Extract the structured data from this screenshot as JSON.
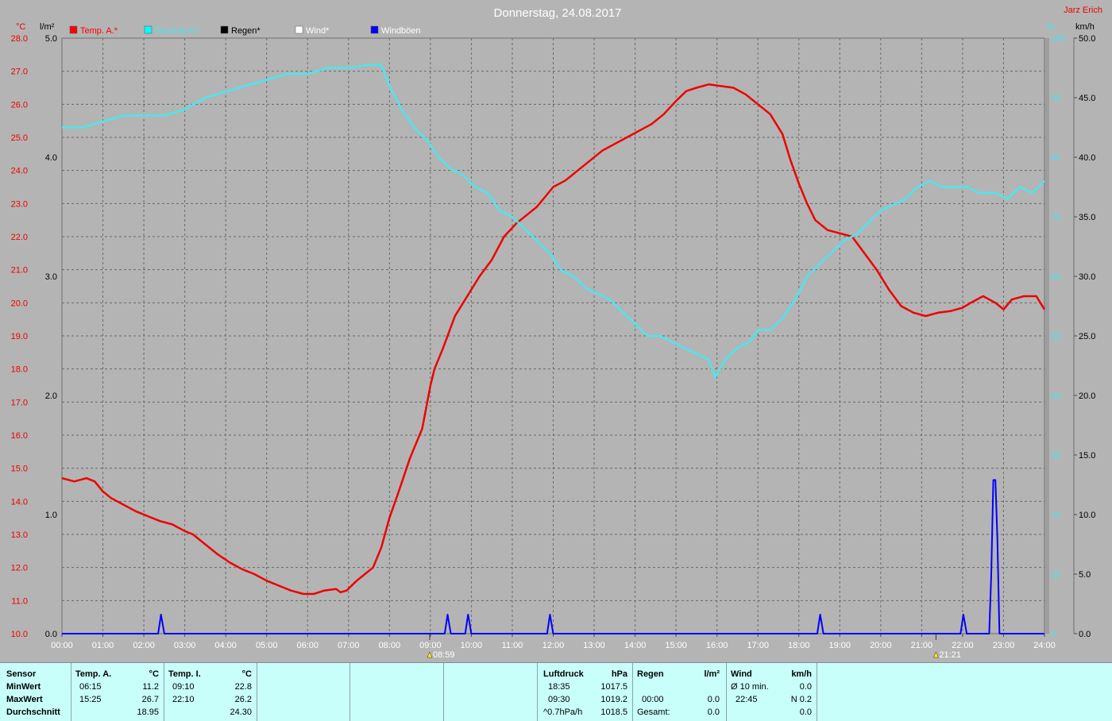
{
  "title": "Donnerstag, 24.08.2017",
  "author": "Jarz Erich",
  "axes": {
    "left_temp_unit": "°C",
    "left_rain_unit": "l/m²",
    "right_hum_unit": "%",
    "right_wind_unit": "km/h"
  },
  "legend": [
    {
      "label": "Temp. A.*",
      "color": "#ff0000",
      "text_color": "#ff0000"
    },
    {
      "label": "Feuchte A.*",
      "color": "#00ffff",
      "text_color": "#44e6ee"
    },
    {
      "label": "Regen*",
      "color": "#000000",
      "text_color": "#000000"
    },
    {
      "label": "Wind*",
      "color": "#ffffff",
      "text_color": "#ffffff"
    },
    {
      "label": "Windböen",
      "color": "#0000ff",
      "text_color": "#ffffff"
    }
  ],
  "markers": [
    {
      "hour": 8.983,
      "label": "08:59"
    },
    {
      "hour": 21.35,
      "label": "21:21"
    }
  ],
  "chart_data": {
    "type": "line",
    "x_unit": "hour",
    "xlim": [
      0,
      24
    ],
    "x_ticks": [
      "00:00",
      "01:00",
      "02:00",
      "03:00",
      "04:00",
      "05:00",
      "06:00",
      "07:00",
      "08:00",
      "09:00",
      "10:00",
      "11:00",
      "12:00",
      "13:00",
      "14:00",
      "15:00",
      "16:00",
      "17:00",
      "18:00",
      "19:00",
      "20:00",
      "21:00",
      "22:00",
      "23:00",
      "24:00"
    ],
    "y_temp": {
      "lim": [
        10,
        28
      ],
      "ticks": [
        "10.0",
        "11.0",
        "12.0",
        "13.0",
        "14.0",
        "15.0",
        "16.0",
        "17.0",
        "18.0",
        "19.0",
        "20.0",
        "21.0",
        "22.0",
        "23.0",
        "24.0",
        "25.0",
        "26.0",
        "27.0",
        "28.0"
      ]
    },
    "y_rain": {
      "lim": [
        0,
        5
      ],
      "ticks": [
        "0.0",
        "1.0",
        "2.0",
        "3.0",
        "4.0",
        "5.0"
      ]
    },
    "y_hum": {
      "lim": [
        0,
        100
      ],
      "ticks": [
        "0",
        "10",
        "20",
        "30",
        "40",
        "50",
        "60",
        "70",
        "80",
        "90",
        "100"
      ]
    },
    "y_wind": {
      "lim": [
        0,
        50
      ],
      "ticks": [
        "0.0",
        "5.0",
        "10.0",
        "15.0",
        "20.0",
        "25.0",
        "30.0",
        "35.0",
        "40.0",
        "45.0",
        "50.0"
      ]
    },
    "grid": true,
    "series": [
      {
        "name": "Temp. A.*",
        "axis": "temp",
        "color": "#ee0000",
        "x": [
          0,
          0.3,
          0.6,
          0.8,
          1.0,
          1.2,
          1.5,
          1.8,
          2.1,
          2.4,
          2.7,
          3.0,
          3.2,
          3.5,
          3.8,
          4.1,
          4.4,
          4.7,
          5.0,
          5.3,
          5.6,
          5.9,
          6.15,
          6.4,
          6.7,
          6.8,
          6.95,
          7.2,
          7.4,
          7.6,
          7.8,
          8.0,
          8.2,
          8.5,
          8.8,
          9.0,
          9.1,
          9.3,
          9.6,
          9.9,
          10.2,
          10.5,
          10.8,
          11.1,
          11.4,
          11.6,
          11.8,
          12.0,
          12.3,
          12.6,
          12.9,
          13.2,
          13.5,
          13.8,
          14.1,
          14.4,
          14.7,
          15.0,
          15.25,
          15.5,
          15.8,
          16.1,
          16.4,
          16.7,
          17.0,
          17.3,
          17.6,
          17.8,
          18.0,
          18.2,
          18.4,
          18.7,
          19.0,
          19.3,
          19.6,
          19.9,
          20.2,
          20.5,
          20.8,
          21.1,
          21.4,
          21.7,
          22.0,
          22.2,
          22.5,
          22.8,
          23.0,
          23.2,
          23.5,
          23.8,
          24.0
        ],
        "y": [
          14.7,
          14.6,
          14.7,
          14.6,
          14.3,
          14.1,
          13.9,
          13.7,
          13.55,
          13.4,
          13.3,
          13.1,
          13.0,
          12.7,
          12.4,
          12.15,
          11.95,
          11.8,
          11.6,
          11.45,
          11.3,
          11.2,
          11.2,
          11.3,
          11.35,
          11.25,
          11.3,
          11.6,
          11.8,
          12.0,
          12.6,
          13.5,
          14.2,
          15.3,
          16.2,
          17.5,
          18.0,
          18.6,
          19.6,
          20.2,
          20.8,
          21.3,
          22.0,
          22.4,
          22.7,
          22.9,
          23.2,
          23.5,
          23.7,
          24.0,
          24.3,
          24.6,
          24.8,
          25.0,
          25.2,
          25.4,
          25.7,
          26.1,
          26.4,
          26.5,
          26.6,
          26.55,
          26.5,
          26.3,
          26.0,
          25.7,
          25.1,
          24.3,
          23.6,
          23.0,
          22.5,
          22.2,
          22.1,
          22.0,
          21.5,
          21.0,
          20.4,
          19.9,
          19.7,
          19.6,
          19.7,
          19.75,
          19.85,
          20.0,
          20.2,
          20.0,
          19.8,
          20.1,
          20.2,
          20.2,
          19.8
        ]
      },
      {
        "name": "Feuchte A.*",
        "axis": "hum",
        "color": "#4ce6ee",
        "x": [
          0,
          0.5,
          1.0,
          1.5,
          2.0,
          2.5,
          3.0,
          3.5,
          4.0,
          4.5,
          5.0,
          5.5,
          6.0,
          6.5,
          7.0,
          7.5,
          7.8,
          8.0,
          8.3,
          8.6,
          8.9,
          9.2,
          9.5,
          9.8,
          10.1,
          10.4,
          10.7,
          11.0,
          11.3,
          11.6,
          11.9,
          12.2,
          12.5,
          12.8,
          13.1,
          13.4,
          13.7,
          14.0,
          14.3,
          14.6,
          14.9,
          15.2,
          15.5,
          15.8,
          15.95,
          16.2,
          16.5,
          16.8,
          17.0,
          17.3,
          17.6,
          17.9,
          18.2,
          18.5,
          18.8,
          19.1,
          19.4,
          19.7,
          20.0,
          20.3,
          20.6,
          20.9,
          21.2,
          21.5,
          21.8,
          22.1,
          22.4,
          22.8,
          23.1,
          23.4,
          23.7,
          24.0
        ],
        "y": [
          85,
          85,
          86,
          87,
          87,
          87,
          88,
          90,
          91,
          92,
          93,
          94,
          94,
          95,
          95,
          95.5,
          95.5,
          92,
          88,
          85,
          83,
          80,
          78,
          77,
          75,
          74,
          71,
          70,
          68,
          66,
          64,
          61,
          60,
          58,
          57,
          56,
          54,
          52,
          50,
          50,
          49,
          48,
          47,
          46,
          43,
          46,
          48,
          49,
          51,
          51,
          53,
          56,
          60,
          62,
          64,
          66,
          67,
          69,
          71,
          72,
          73,
          75,
          76,
          75,
          75,
          75,
          74,
          74,
          73,
          75,
          74,
          76
        ]
      },
      {
        "name": "Windböen",
        "axis": "wind",
        "color": "#0000ff",
        "x": [
          0,
          2.35,
          2.42,
          2.5,
          9.35,
          9.42,
          9.5,
          9.85,
          9.92,
          10.0,
          11.85,
          11.92,
          12.0,
          18.45,
          18.52,
          18.6,
          21.95,
          22.02,
          22.1,
          22.65,
          22.7,
          22.75,
          22.8,
          22.85,
          22.9,
          24.0
        ],
        "y": [
          0,
          0,
          1.6,
          0,
          0,
          1.6,
          0,
          0,
          1.6,
          0,
          0,
          1.6,
          0,
          0,
          1.6,
          0,
          0,
          1.6,
          0,
          0,
          5,
          12.9,
          12.9,
          8,
          0,
          0
        ]
      }
    ]
  },
  "stats": {
    "sensor_header": "Sensor",
    "row_labels": [
      "MinWert",
      "MaxWert",
      "Durchschnitt"
    ],
    "temp_a": {
      "header": "Temp. A.",
      "unit": "°C",
      "min_time": "06:15",
      "min": "11.2",
      "max_time": "15:25",
      "max": "26.7",
      "avg": "18.95"
    },
    "temp_i": {
      "header": "Temp. I.",
      "unit": "°C",
      "min_time": "09:10",
      "min": "22.8",
      "max_time": "22:10",
      "max": "26.2",
      "avg": "24.30"
    },
    "pressure": {
      "header": "Luftdruck",
      "unit": "hPa",
      "min_time": "18:35",
      "min": "1017.5",
      "max_time": "09:30",
      "max": "1019.2",
      "trend": "^0.7hPa/h",
      "current": "1018.5"
    },
    "rain": {
      "header": "Regen",
      "unit": "l/m²",
      "max_time": "00:00",
      "max": "0.0",
      "total_label": "Gesamt:",
      "total": "0.0"
    },
    "wind": {
      "header": "Wind",
      "unit": "km/h",
      "min_label": "Ø 10 min.",
      "min": "0.0",
      "max_time": "22:45",
      "max": "N 0.2",
      "avg": "0.0"
    }
  }
}
